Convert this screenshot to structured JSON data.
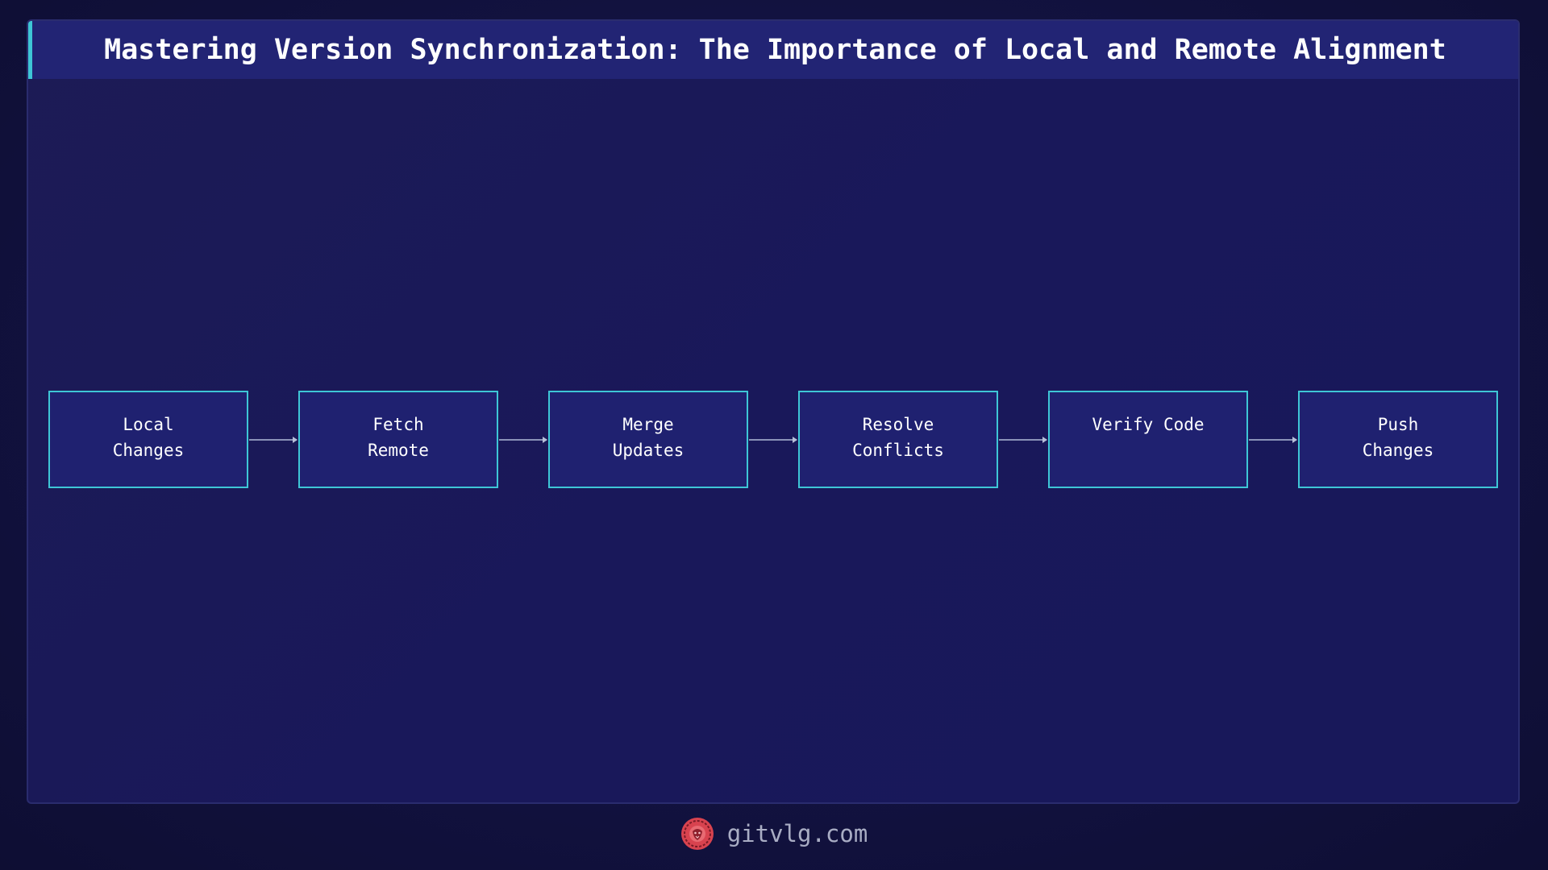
{
  "title": "Mastering Version Synchronization: The Importance of Local and Remote Alignment",
  "flow": {
    "steps": [
      {
        "label": "Local\nChanges"
      },
      {
        "label": "Fetch\nRemote"
      },
      {
        "label": "Merge\nUpdates"
      },
      {
        "label": "Resolve\nConflicts"
      },
      {
        "label": "Verify Code"
      },
      {
        "label": "Push\nChanges"
      }
    ]
  },
  "footer": {
    "site": "gitvlg.com",
    "logo_icon": "lion-logo-icon"
  },
  "colors": {
    "background": "#121240",
    "panel": "#1b1a57",
    "title_bar": "#222474",
    "accent": "#3ec6d6",
    "node_fill": "#1f2170",
    "logo": "#d8434f"
  }
}
